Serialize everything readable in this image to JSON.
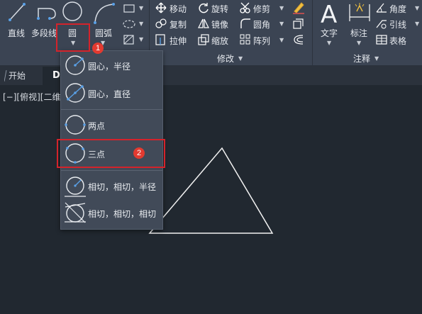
{
  "ribbon": {
    "draw": {
      "line_label": "直线",
      "polyline_label": "多段线",
      "circle_label": "圆",
      "arc_label": "圆弧"
    },
    "modify": {
      "move": "移动",
      "rotate": "旋转",
      "trim": "修剪",
      "copy": "复制",
      "mirror": "镜像",
      "fillet": "圆角",
      "stretch": "拉伸",
      "scale": "缩放",
      "array": "阵列",
      "panel_title": "修改"
    },
    "annotation": {
      "text": "文字",
      "dimension": "标注",
      "angle": "角度",
      "leader": "引线",
      "table": "表格",
      "panel_title": "注释"
    }
  },
  "tabs": {
    "start": "开始",
    "drawing": "D"
  },
  "viewport_label": "[−][俯视][二维",
  "circle_menu": {
    "items": [
      {
        "label": "圆心，半径",
        "icon": "circle-center-radius-icon"
      },
      {
        "label": "圆心，直径",
        "icon": "circle-center-diameter-icon"
      },
      {
        "label": "两点",
        "icon": "circle-2point-icon"
      },
      {
        "label": "三点",
        "icon": "circle-3point-icon"
      },
      {
        "label": "相切，相切，半径",
        "icon": "circle-ttr-icon"
      },
      {
        "label": "相切，相切，相切",
        "icon": "circle-ttt-icon"
      }
    ]
  },
  "badges": {
    "step1": "1",
    "step2": "2"
  },
  "colors": {
    "ribbon": "#3b4453",
    "canvas": "#212830",
    "menu": "#414a58",
    "highlight": "#d4232b",
    "badge": "#e23a30"
  }
}
